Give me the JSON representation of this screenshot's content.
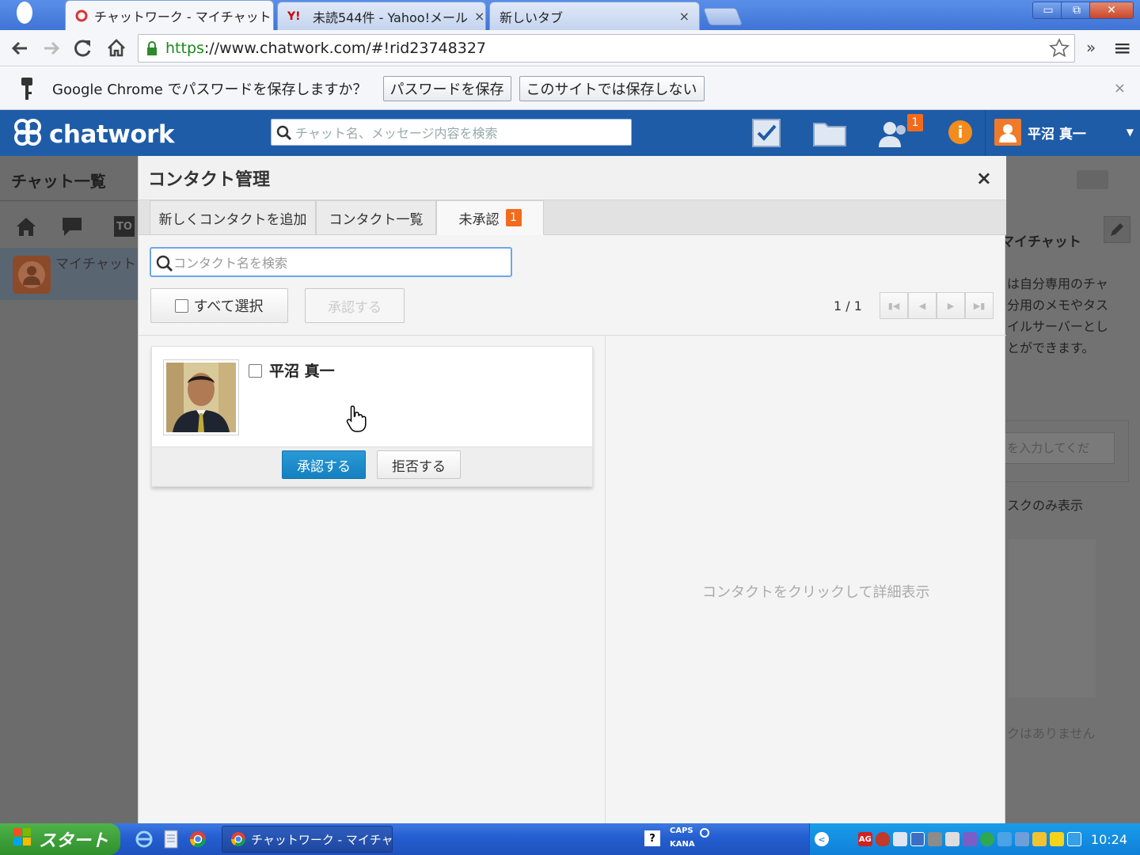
{
  "browser": {
    "tabs": [
      {
        "title": "チャットワーク - マイチャット",
        "close": "×"
      },
      {
        "title": "未読544件 - Yahoo!メール",
        "close": "×"
      },
      {
        "title": "新しいタブ",
        "close": "×"
      }
    ],
    "yahoo_mark": "Y!",
    "window_buttons": {
      "minimize": "▭",
      "restore": "⧉",
      "close": "✕"
    },
    "url_scheme": "https",
    "url_rest": "://www.chatwork.com/#!rid23748327",
    "extensions": "»",
    "menu": "≡",
    "password_bar": {
      "message": "Google Chrome でパスワードを保存しますか？",
      "save_label": "パスワードを保存",
      "never_label": "このサイトでは保存しない",
      "close": "×"
    }
  },
  "header": {
    "logo_text": "chatwork",
    "search_placeholder": "チャット名、メッセージ内容を検索",
    "contacts_badge": "1",
    "info_mark": "i",
    "user_name": "平沼 真一",
    "dropdown": "▼"
  },
  "left_pane": {
    "title": "チャット一覧",
    "to_label": "TO",
    "room_name": "マイチャット"
  },
  "right_pane": {
    "chat_title": "マイチャット",
    "desc_lines": [
      "は自分専用のチャ",
      "分用のメモやタス",
      "イルサーバーとし",
      "とができます。"
    ],
    "task_input": "を入力してくだ",
    "task_filter": "スクのみ表示",
    "no_task": "クはありません"
  },
  "modal": {
    "title": "コンタクト管理",
    "close": "×",
    "tabs": [
      {
        "label": "新しくコンタクトを追加"
      },
      {
        "label": "コンタクト一覧"
      },
      {
        "label": "未承認",
        "badge": "1"
      }
    ],
    "search_placeholder": "コンタクト名を検索",
    "select_all_label": "すべて選択",
    "bulk_approve_label": "承認する",
    "pagination": "1 / 1",
    "contact": {
      "name": "平沼 真一",
      "approve_label": "承認する",
      "reject_label": "拒否する"
    },
    "detail_hint": "コンタクトをクリックして詳細表示"
  },
  "taskbar": {
    "start_label": "スタート",
    "window_title": "チャットワーク - マイチャ...",
    "caps": "CAPS",
    "kana": "KANA",
    "ime_label": "?",
    "av_label": "AG",
    "clock": "10:24"
  }
}
